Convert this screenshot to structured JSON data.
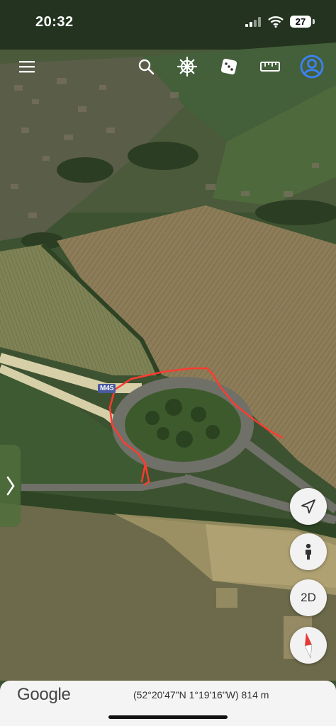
{
  "status_bar": {
    "time": "20:32",
    "battery": "27"
  },
  "toolbar": {
    "menu_icon": "menu-icon",
    "search_icon": "search-icon",
    "voyager_icon": "ship-wheel-icon",
    "feeling_lucky_icon": "dice-icon",
    "measure_icon": "ruler-icon",
    "account_icon": "account-icon"
  },
  "map": {
    "road_label": "M45"
  },
  "controls": {
    "my_location_icon": "location-arrow-icon",
    "street_view_icon": "pegman-icon",
    "view_mode_label": "2D",
    "compass_icon": "compass-icon"
  },
  "footer": {
    "logo": "Google",
    "coordinates": "(52°20'47\"N 1°19'16\"W) 814 m"
  },
  "colors": {
    "accent": "#3b82f6",
    "drawn_path": "#ff3b30",
    "field": "#8a7a56",
    "grass": "#3f5a30"
  }
}
